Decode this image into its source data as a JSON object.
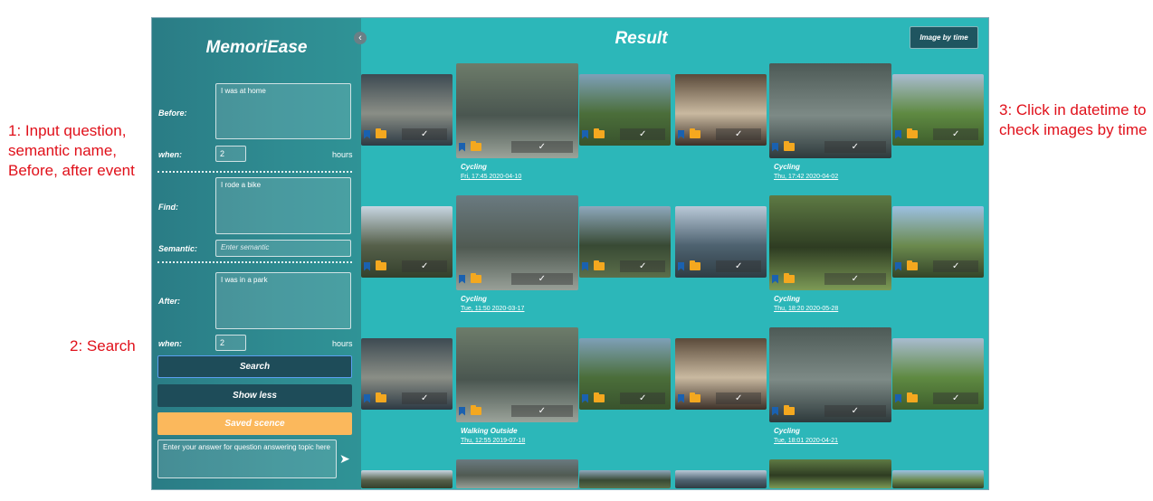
{
  "annotations": {
    "a1": "1: Input question, semantic name, Before, after event",
    "a2": "2: Search",
    "a3": "3: Click in datetime to check images by time"
  },
  "sidebar": {
    "app_name": "MemoriEase",
    "collapse_icon": "‹",
    "before_label": "Before:",
    "before_value": "I was at home",
    "when_label": "when:",
    "before_when_value": "2",
    "hours_label": "hours",
    "find_label": "Find:",
    "find_value": "I rode a bike",
    "semantic_label": "Semantic:",
    "semantic_placeholder": "Enter semantic",
    "after_label": "After:",
    "after_value": "I was in a park",
    "after_when_value": "2",
    "search_label": "Search",
    "show_less_label": "Show less",
    "saved_label": "Saved scence",
    "qa_placeholder": "Enter your answer for question answering topic here",
    "send_icon": "➤"
  },
  "main": {
    "title": "Result",
    "image_by_time": "Image by time",
    "events": [
      {
        "name": "Cycling",
        "date": "Fri, 17:45 2020-04-10"
      },
      {
        "name": "Cycling",
        "date": "Thu, 17:42 2020-04-02"
      },
      {
        "name": "Cycling",
        "date": "Tue, 11:50 2020-03-17"
      },
      {
        "name": "Cycling",
        "date": "Thu, 18:20 2020-05-28"
      },
      {
        "name": "Walking Outside",
        "date": "Thu, 12:55 2019-07-18"
      },
      {
        "name": "Cycling",
        "date": "Tue, 18:01 2020-04-21"
      }
    ]
  },
  "icons": {
    "bookmark": "bookmark-icon",
    "folder": "folder-open-icon",
    "check": "check-icon",
    "send": "send-icon",
    "collapse": "chevron-left-icon"
  },
  "colors": {
    "main_bg": "#2cb7b9",
    "sidebar_bg": "#2f8b91",
    "button_dark": "#1e4c59",
    "saved_button": "#fbb85c",
    "bookmark": "#1a61b0",
    "folder": "#f4a81f",
    "annotation": "#e0101a"
  }
}
